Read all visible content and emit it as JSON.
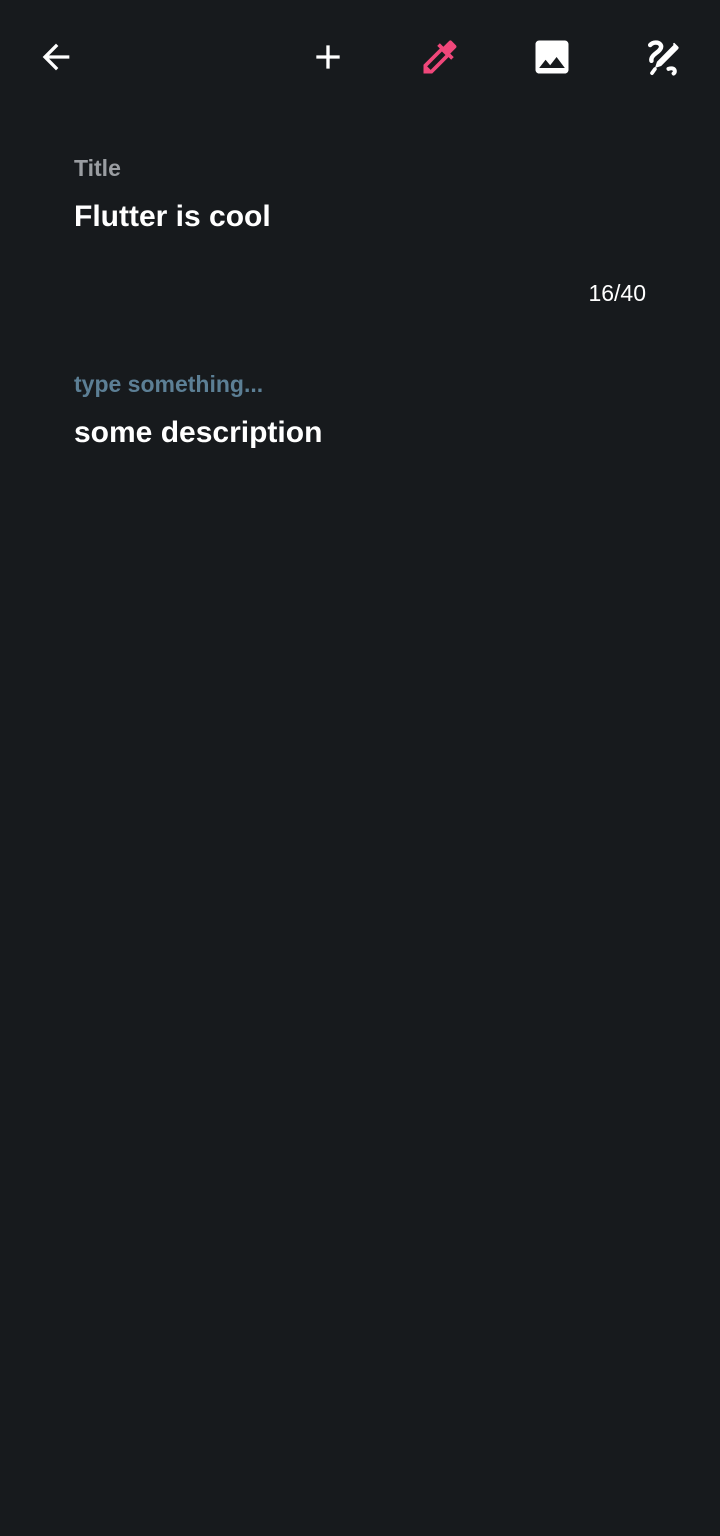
{
  "colors": {
    "background": "#171a1d",
    "icon": "#ffffff",
    "accent": "#f0477a",
    "title_label": "#9a9da1",
    "description_label": "#5c7f95",
    "text": "#ffffff"
  },
  "toolbar": {
    "icons": [
      "arrow-back-icon",
      "add-icon",
      "color-picker-icon",
      "image-icon",
      "draw-icon"
    ]
  },
  "title_field": {
    "label": "Title",
    "value": "Flutter is cool",
    "counter": "16/40"
  },
  "description_field": {
    "label": "type something...",
    "value": "some description"
  }
}
